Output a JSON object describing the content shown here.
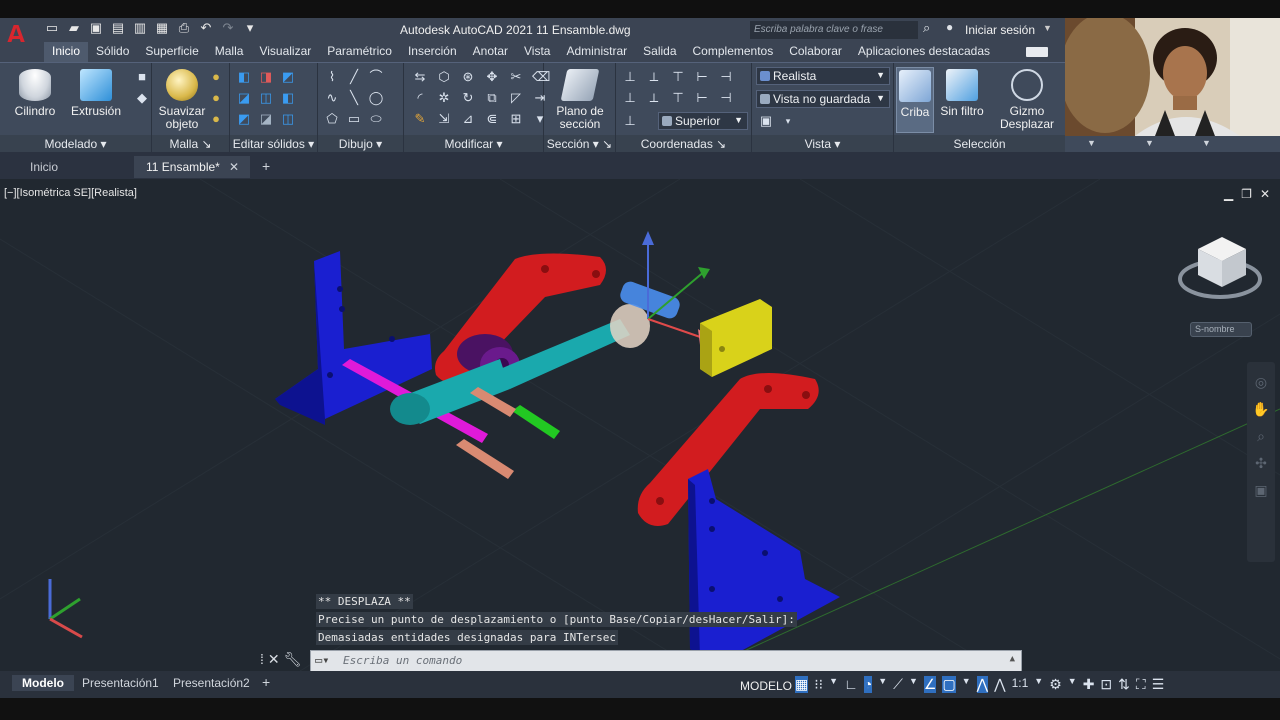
{
  "app": {
    "window_title": "Autodesk AutoCAD 2021    11 Ensamble.dwg",
    "logo": "A",
    "search_placeholder": "Escriba palabra clave o frase",
    "signin": "Iniciar sesión"
  },
  "ribbon_tabs": [
    "Inicio",
    "Sólido",
    "Superficie",
    "Malla",
    "Visualizar",
    "Paramétrico",
    "Inserción",
    "Anotar",
    "Vista",
    "Administrar",
    "Salida",
    "Complementos",
    "Colaborar",
    "Aplicaciones destacadas"
  ],
  "active_tab": "Inicio",
  "panels": {
    "modelado": {
      "label": "Modelado",
      "cilindro": "Cilindro",
      "extrusion": "Extrusión"
    },
    "malla": {
      "label": "Malla",
      "suavizar": "Suavizar objeto"
    },
    "editar_solidos": {
      "label": "Editar sólidos"
    },
    "dibujo": {
      "label": "Dibujo"
    },
    "modificar": {
      "label": "Modificar"
    },
    "seccion": {
      "label": "Sección",
      "plano": "Plano de sección"
    },
    "coordenadas": {
      "label": "Coordenadas",
      "superior": "Superior"
    },
    "vista": {
      "label": "Vista",
      "estilo_visual": "Realista",
      "vista_guardada": "Vista no guardada"
    },
    "seleccion": {
      "label": "Selección",
      "criba": "Criba",
      "sin_filtro": "Sin filtro",
      "gizmo": "Gizmo Desplazar"
    }
  },
  "doc_tabs": {
    "inicio": "Inicio",
    "file": "11 Ensamble*"
  },
  "viewport": {
    "label": "[−][Isométrica SE][Realista]",
    "wcs": "S-nombre",
    "viewcube_faces": [
      "ARRIBA",
      "DERECHA",
      "FRENTE"
    ]
  },
  "command": {
    "history": [
      "** DESPLAZA **",
      "Precise un punto de desplazamiento o [punto Base/Copiar/desHacer/Salir]:",
      "Demasiadas entidades designadas para INTersec"
    ],
    "placeholder": "Escriba un comando"
  },
  "status": {
    "layouts": [
      "Modelo",
      "Presentación1",
      "Presentación2"
    ],
    "active_layout": "Modelo",
    "model_label": "MODELO",
    "scale": "1:1"
  },
  "colors": {
    "ribbon_bg": "#3f4a5b",
    "viewport_bg": "#212830",
    "accent": "#2f6fc0",
    "part_blue": "#1a1fd0",
    "part_red": "#d21c1f",
    "part_cyan": "#1aa9ad",
    "part_magenta": "#e01ad9",
    "part_yellow": "#d9d21a",
    "part_purple": "#6a1a8c",
    "part_green": "#22c922",
    "part_salmon": "#d98a72"
  }
}
